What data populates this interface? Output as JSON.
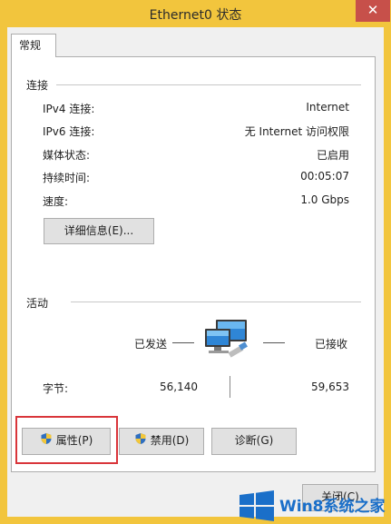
{
  "window": {
    "title": "Ethernet0 状态",
    "close_glyph": "✕"
  },
  "tabs": [
    {
      "label": "常规",
      "selected": true
    }
  ],
  "connection": {
    "section_label": "连接",
    "rows": [
      {
        "label": "IPv4 连接:",
        "value": "Internet"
      },
      {
        "label": "IPv6 连接:",
        "value": "无 Internet 访问权限"
      },
      {
        "label": "媒体状态:",
        "value": "已启用"
      },
      {
        "label": "持续时间:",
        "value": "00:05:07"
      },
      {
        "label": "速度:",
        "value": "1.0 Gbps"
      }
    ],
    "details_button": "详细信息(E)..."
  },
  "activity": {
    "section_label": "活动",
    "sent_label": "已发送",
    "received_label": "已接收",
    "bytes_label": "字节:",
    "bytes_sent": "56,140",
    "bytes_received": "59,653",
    "icon": "network-computers-icon"
  },
  "buttons": {
    "properties": "属性(P)",
    "disable": "禁用(D)",
    "diagnose": "诊断(G)",
    "close": "关闭(C)"
  },
  "watermark": {
    "text": "Win8系统之家",
    "icon": "windows-logo-icon"
  },
  "colors": {
    "title_bar": "#f2c53d",
    "close_button": "#c7504a",
    "highlight_box": "#d9353a",
    "shield_blue": "#2f6fc0",
    "shield_yellow": "#f3c73a",
    "watermark_blue": "#1a6fc9"
  }
}
